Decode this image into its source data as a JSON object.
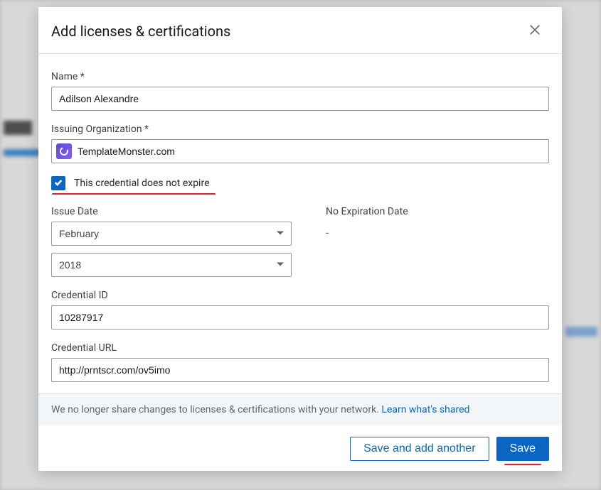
{
  "header": {
    "title": "Add licenses & certifications"
  },
  "form": {
    "name": {
      "label": "Name *",
      "value": "Adilson Alexandre"
    },
    "org": {
      "label": "Issuing Organization *",
      "value": "TemplateMonster.com"
    },
    "noexpire": {
      "label": "This credential does not expire",
      "checked": true
    },
    "issue": {
      "label": "Issue Date",
      "month": "February",
      "year": "2018"
    },
    "expiration": {
      "label": "No Expiration Date",
      "dash": "-"
    },
    "cred_id": {
      "label": "Credential ID",
      "value": "10287917"
    },
    "cred_url": {
      "label": "Credential URL",
      "value": "http://prntscr.com/ov5imo"
    }
  },
  "banner": {
    "text": "We no longer share changes to licenses & certifications with your network. ",
    "link": "Learn what's shared"
  },
  "footer": {
    "save_another": "Save and add another",
    "save": "Save"
  }
}
